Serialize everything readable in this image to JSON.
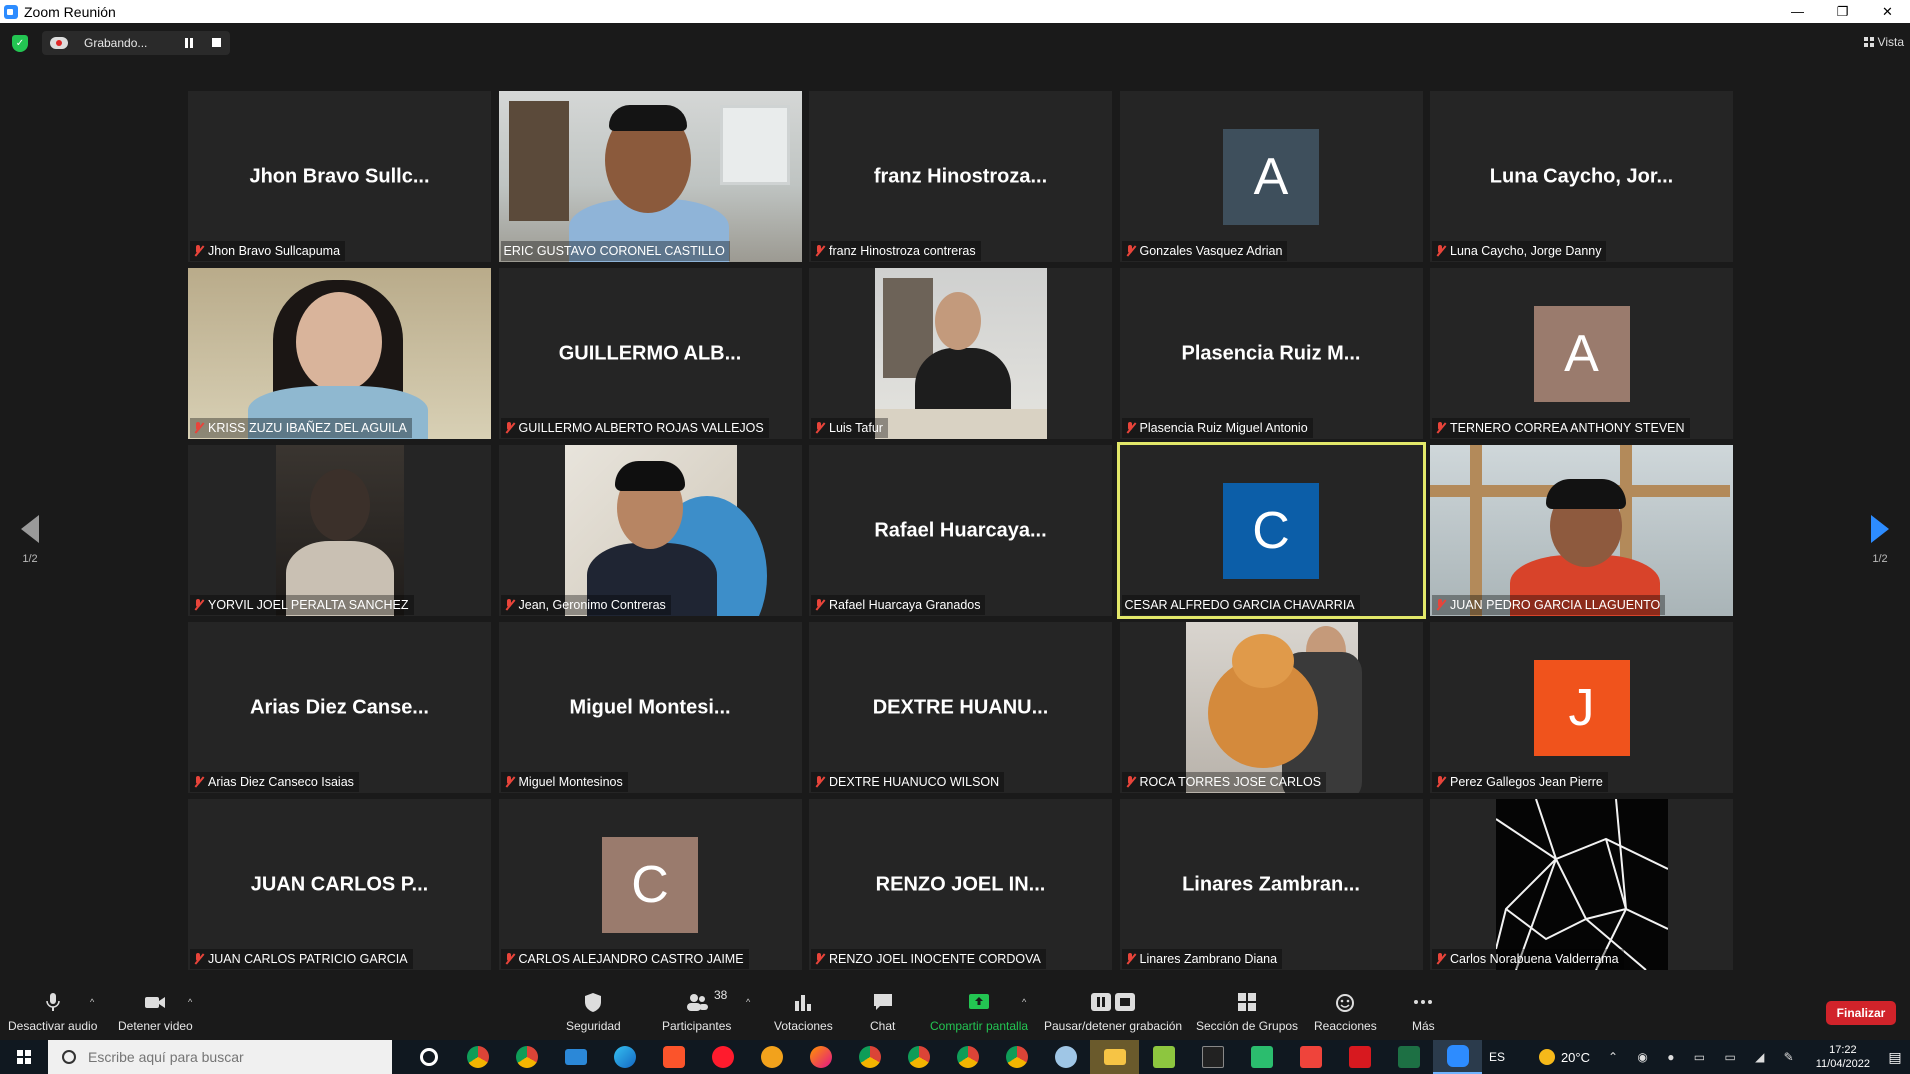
{
  "window": {
    "title": "Zoom Reunión",
    "minimize": "—",
    "restore": "❐",
    "close": "✕"
  },
  "recording": {
    "status": "Grabando..."
  },
  "view": {
    "label": "Vista"
  },
  "pagination": {
    "left": "1/2",
    "right": "1/2"
  },
  "tiles": [
    {
      "display": "Jhon Bravo Sullc...",
      "label": "Jhon Bravo Sullcapuma",
      "kind": "name"
    },
    {
      "display": "",
      "label": "ERIC GUSTAVO CORONEL CASTILLO",
      "kind": "video"
    },
    {
      "display": "franz Hinostroza...",
      "label": "franz Hinostroza contreras",
      "kind": "name"
    },
    {
      "display": "A",
      "label": "Gonzales Vasquez Adrian",
      "kind": "avatar",
      "color": "#3e4f5c"
    },
    {
      "display": "Luna Caycho, Jor...",
      "label": "Luna Caycho, Jorge Danny",
      "kind": "name"
    },
    {
      "display": "",
      "label": "KRISS ZUZU IBAÑEZ DEL AGUILA",
      "kind": "video"
    },
    {
      "display": "GUILLERMO ALB...",
      "label": "GUILLERMO ALBERTO ROJAS VALLEJOS",
      "kind": "name"
    },
    {
      "display": "",
      "label": "Luis Tafur",
      "kind": "video"
    },
    {
      "display": "Plasencia Ruiz M...",
      "label": "Plasencia Ruiz Miguel Antonio",
      "kind": "name"
    },
    {
      "display": "A",
      "label": "TERNERO CORREA ANTHONY STEVEN",
      "kind": "avatar",
      "color": "#9a7b6d"
    },
    {
      "display": "",
      "label": "YORVIL JOEL PERALTA SANCHEZ",
      "kind": "video"
    },
    {
      "display": "",
      "label": "Jean, Geronimo Contreras",
      "kind": "video"
    },
    {
      "display": "Rafael Huarcaya...",
      "label": "Rafael Huarcaya Granados",
      "kind": "name"
    },
    {
      "display": "C",
      "label": "CESAR ALFREDO GARCIA CHAVARRIA",
      "kind": "avatar",
      "color": "#0c5ea8",
      "active": true
    },
    {
      "display": "",
      "label": "JUAN PEDRO GARCIA LLAGUENTO",
      "kind": "video"
    },
    {
      "display": "Arias Diez Canse...",
      "label": "Arias Diez Canseco Isaias",
      "kind": "name"
    },
    {
      "display": "Miguel Montesi...",
      "label": "Miguel Montesinos",
      "kind": "name"
    },
    {
      "display": "DEXTRE HUANU...",
      "label": "DEXTRE HUANUCO WILSON",
      "kind": "name"
    },
    {
      "display": "",
      "label": "ROCA TORRES JOSE CARLOS",
      "kind": "video"
    },
    {
      "display": "J",
      "label": "Perez Gallegos Jean Pierre",
      "kind": "avatar",
      "color": "#f0531c"
    },
    {
      "display": "JUAN CARLOS P...",
      "label": "JUAN CARLOS PATRICIO GARCIA",
      "kind": "name"
    },
    {
      "display": "C",
      "label": "CARLOS ALEJANDRO CASTRO JAIME",
      "kind": "avatar",
      "color": "#9a7b6d"
    },
    {
      "display": "RENZO JOEL IN...",
      "label": "RENZO JOEL INOCENTE CORDOVA",
      "kind": "name"
    },
    {
      "display": "Linares Zambran...",
      "label": "Linares Zambrano Diana",
      "kind": "name"
    },
    {
      "display": "",
      "label": "Carlos Norabuena Valderrama",
      "kind": "video"
    }
  ],
  "toolbar": {
    "audio": "Desactivar audio",
    "video": "Detener video",
    "security": "Seguridad",
    "participants": "Participantes",
    "participants_count": "38",
    "polls": "Votaciones",
    "chat": "Chat",
    "share": "Compartir pantalla",
    "record": "Pausar/detener grabación",
    "breakout": "Sección de Grupos",
    "reactions": "Reacciones",
    "more": "Más",
    "end": "Finalizar"
  },
  "taskbar": {
    "search_placeholder": "Escribe aquí para buscar",
    "lang": "ES",
    "weather": "20°C",
    "time": "17:22",
    "date": "11/04/2022"
  }
}
